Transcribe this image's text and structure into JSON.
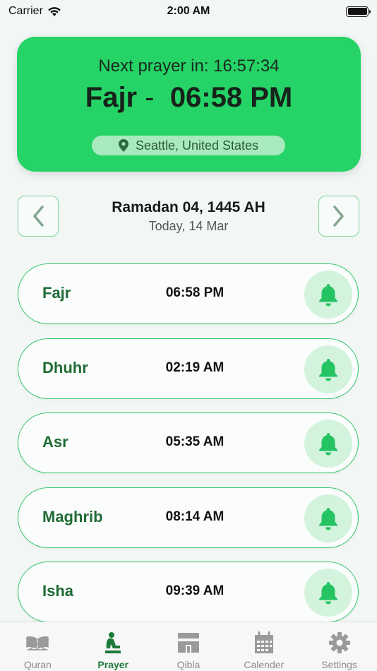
{
  "status_bar": {
    "carrier": "Carrier",
    "time": "2:00 AM"
  },
  "header": {
    "next_prayer_text": "Next prayer in: 16:57:34",
    "current_name": "Fajr",
    "separator": "-",
    "current_time": "06:58 PM",
    "location": "Seattle, United States"
  },
  "date": {
    "hijri": "Ramadan 04, 1445 AH",
    "gregorian": "Today, 14 Mar"
  },
  "prayers": [
    {
      "name": "Fajr",
      "time": "06:58 PM"
    },
    {
      "name": "Dhuhr",
      "time": "02:19 AM"
    },
    {
      "name": "Asr",
      "time": "05:35 AM"
    },
    {
      "name": "Maghrib",
      "time": "08:14 AM"
    },
    {
      "name": "Isha",
      "time": "09:39 AM"
    }
  ],
  "tabs": [
    {
      "label": "Quran",
      "icon": "quran-book-icon",
      "active": false
    },
    {
      "label": "Prayer",
      "icon": "prayer-person-icon",
      "active": true
    },
    {
      "label": "Qibla",
      "icon": "kaaba-icon",
      "active": false
    },
    {
      "label": "Calender",
      "icon": "calendar-icon",
      "active": false
    },
    {
      "label": "Settings",
      "icon": "gear-icon",
      "active": false
    }
  ],
  "colors": {
    "accent": "#25d366",
    "dark_green": "#1f6b35",
    "row_border": "#36c46a",
    "bell_bg": "#d3f3dd"
  }
}
